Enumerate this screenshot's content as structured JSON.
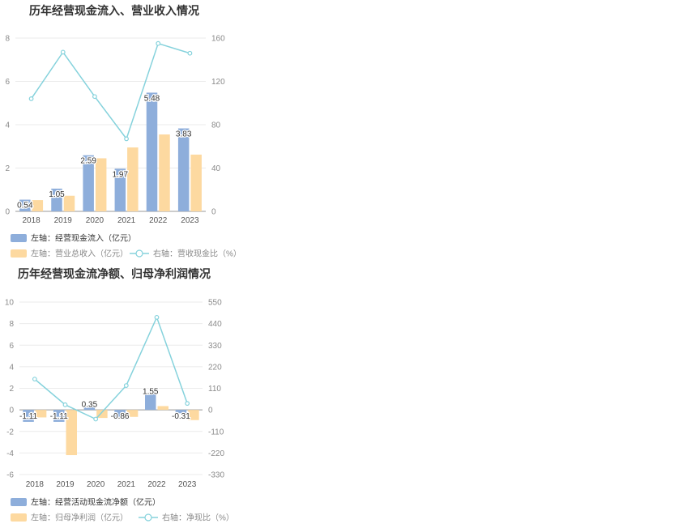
{
  "colors": {
    "bar_primary": "#8eaedb",
    "bar_secondary": "#fdd9a0",
    "line": "#85d2dc",
    "grid": "#ebebeb",
    "axis": "#999999"
  },
  "chart_data": [
    {
      "type": "bar",
      "title": "历年经营现金流入、营业收入情况",
      "categories": [
        "2018",
        "2019",
        "2020",
        "2021",
        "2022",
        "2023"
      ],
      "series": [
        {
          "name": "左轴：经营现金流入（亿元）",
          "axis": "left",
          "type": "bar",
          "values": [
            0.54,
            1.05,
            2.59,
            1.97,
            5.48,
            3.83
          ],
          "labels": [
            "0.54",
            "1.05",
            "2.59",
            "1.97",
            "5.48",
            "3.83"
          ]
        },
        {
          "name": "左轴：营业总收入（亿元）",
          "axis": "left",
          "type": "bar",
          "values": [
            0.52,
            0.72,
            2.45,
            2.95,
            3.55,
            2.62
          ]
        },
        {
          "name": "右轴：营收现金比（%）",
          "axis": "right",
          "type": "line",
          "values": [
            104,
            147,
            106,
            67,
            155,
            146
          ]
        }
      ],
      "ylim_left": [
        0,
        8
      ],
      "yticks_left": [
        "0",
        "2",
        "4",
        "6",
        "8"
      ],
      "ylim_right": [
        0,
        160
      ],
      "yticks_right": [
        "0",
        "40",
        "80",
        "120",
        "160"
      ],
      "grid": true,
      "legend_position": "bottom-left"
    },
    {
      "type": "bar",
      "title": "历年经营现金流净额、归母净利润情况",
      "categories": [
        "2018",
        "2019",
        "2020",
        "2021",
        "2022",
        "2023"
      ],
      "series": [
        {
          "name": "左轴：经营活动现金流净额（亿元）",
          "axis": "left",
          "type": "bar",
          "values": [
            -1.11,
            -1.11,
            0.35,
            -0.86,
            1.55,
            -0.31
          ],
          "labels": [
            "-1.11",
            "-1.11",
            "0.35",
            "-0.86",
            "1.55",
            "-0.31"
          ]
        },
        {
          "name": "左轴：归母净利润（亿元）",
          "axis": "left",
          "type": "bar",
          "values": [
            -0.7,
            -4.2,
            -0.75,
            -0.65,
            0.35,
            -0.95
          ]
        },
        {
          "name": "右轴：净现比（%）",
          "axis": "right",
          "type": "line",
          "values": [
            157,
            26,
            -47,
            124,
            472,
            33
          ]
        }
      ],
      "ylim_left": [
        -6,
        10
      ],
      "yticks_left": [
        "-6",
        "-4",
        "-2",
        "0",
        "2",
        "4",
        "6",
        "8",
        "10"
      ],
      "ylim_right": [
        -330,
        550
      ],
      "yticks_right": [
        "-330",
        "-220",
        "-110",
        "0",
        "110",
        "220",
        "330",
        "440",
        "550"
      ],
      "grid": true,
      "legend_position": "bottom-left"
    }
  ]
}
